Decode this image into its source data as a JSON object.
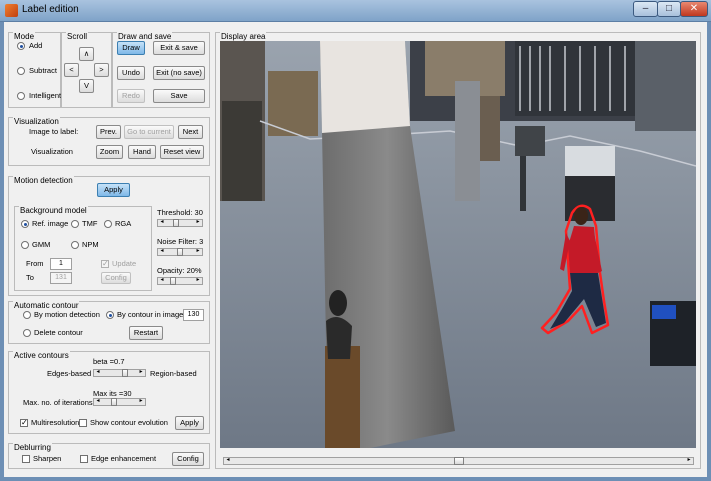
{
  "window": {
    "title": "Label edition",
    "minimize": "–",
    "maximize": "□",
    "close": "✕"
  },
  "mode": {
    "title": "Mode",
    "options": [
      {
        "label": "Add",
        "selected": true
      },
      {
        "label": "Subtract",
        "selected": false
      },
      {
        "label": "Intelligent",
        "selected": false
      }
    ]
  },
  "scroll": {
    "title": "Scroll",
    "up": "∧",
    "left": "<",
    "right": ">",
    "down": "V"
  },
  "draw_save": {
    "title": "Draw and save",
    "draw": "Draw",
    "exit_save": "Exit & save",
    "undo": "Undo",
    "exit_nosave": "Exit (no save)",
    "redo": "Redo",
    "save": "Save"
  },
  "visualization": {
    "title": "Visualization",
    "image_to_label": "Image to label:",
    "prev": "Prev.",
    "go_current": "Go to current",
    "next": "Next",
    "visualization_label": "Visualization",
    "zoom": "Zoom",
    "hand": "Hand",
    "reset_view": "Reset view"
  },
  "motion_detection": {
    "title": "Motion detection",
    "apply": "Apply",
    "background_model": {
      "title": "Background model",
      "ref_image": "Ref. image",
      "tmf": "TMF",
      "rga": "RGA",
      "gmm": "GMM",
      "npm": "NPM",
      "from_label": "From",
      "from_value": "1",
      "to_label": "To",
      "to_value": "131",
      "update": "Update",
      "config": "Config"
    },
    "threshold_label": "Threshold: 30",
    "threshold_level": 0.3,
    "noise_label": "Noise Filter: 3",
    "noise_level": 0.5,
    "opacity_label": "Opacity: 20%",
    "opacity_level": 0.2
  },
  "automatic_contour": {
    "title": "Automatic contour",
    "by_motion": "By motion detection",
    "by_contour": "By contour in image",
    "contour_value": "130",
    "delete": "Delete contour",
    "restart": "Restart"
  },
  "active_contours": {
    "title": "Active contours",
    "beta_label": "beta =0.7",
    "edges_based": "Edges-based",
    "region_based": "Region-based",
    "beta_level": 0.7,
    "max_its_label": "Max its =30",
    "max_iter_label": "Max. no. of iterations:",
    "iter_level": 0.3,
    "multiresolution": "Multiresolution",
    "show_evolution": "Show contour evolution",
    "apply": "Apply"
  },
  "deblurring": {
    "title": "Deblurring",
    "sharpen": "Sharpen",
    "edge_enhancement": "Edge enhancement",
    "config": "Config"
  },
  "display": {
    "title": "Display area",
    "scroll_position": 0.5
  },
  "colors": {
    "accent": "#3c7fb1",
    "contour": "#ff2020",
    "person_shirt": "#c41a28"
  }
}
